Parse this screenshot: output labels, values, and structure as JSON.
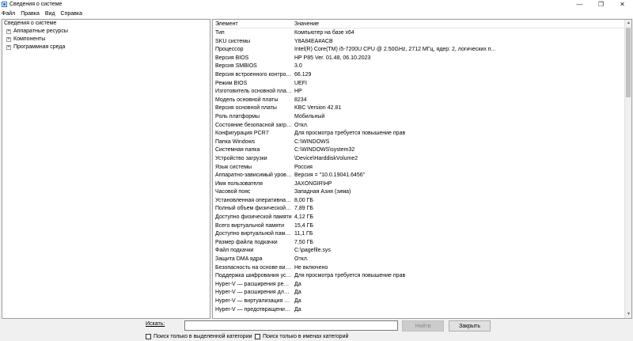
{
  "window": {
    "title": "Сведения о системе",
    "minimize_glyph": "—",
    "maximize_glyph": "❐",
    "close_glyph": "✕"
  },
  "menu": [
    "Файл",
    "Правка",
    "Вид",
    "Справка"
  ],
  "tree": {
    "root": "Сведения о системе",
    "children": [
      "Аппаратные ресурсы",
      "Компоненты",
      "Программная среда"
    ]
  },
  "grid": {
    "headers": {
      "element": "Элемент",
      "value": "Значение"
    },
    "rows": [
      {
        "element": "Тип",
        "value": "Компьютер на базе x64"
      },
      {
        "element": "SKU системы",
        "value": "Y8A84EA#ACB"
      },
      {
        "element": "Процессор",
        "value": "Intel(R) Core(TM) i5-7200U CPU @ 2.50GHz, 2712 МГц, ядер: 2, логических п..."
      },
      {
        "element": "Версия BIOS",
        "value": "HP P85 Ver. 01.48, 06.10.2023"
      },
      {
        "element": "Версия SMBIOS",
        "value": "3.0"
      },
      {
        "element": "Версия встроенного контролл...",
        "value": "66.129"
      },
      {
        "element": "Режим BIOS",
        "value": "UEFI"
      },
      {
        "element": "Изготовитель основной платы",
        "value": "HP"
      },
      {
        "element": "Модель основной платы",
        "value": "8234"
      },
      {
        "element": "Версия основной платы",
        "value": "KBC Version 42.81"
      },
      {
        "element": "Роль платформы",
        "value": "Мобильный"
      },
      {
        "element": "Состояние безопасной загруз...",
        "value": "Откл."
      },
      {
        "element": "Конфигурация PCR7",
        "value": "Для просмотра требуется повышение прав"
      },
      {
        "element": "Папка Windows",
        "value": "C:\\WINDOWS"
      },
      {
        "element": "Системная папка",
        "value": "C:\\WINDOWS\\system32"
      },
      {
        "element": "Устройство загрузки",
        "value": "\\Device\\HarddiskVolume2"
      },
      {
        "element": "Язык системы",
        "value": "Россия"
      },
      {
        "element": "Аппаратно-зависимый уровен...",
        "value": "Версия = \"10.0.19041.6456\""
      },
      {
        "element": "Имя пользователя",
        "value": "JAXONGIR\\HP"
      },
      {
        "element": "Часовой пояс",
        "value": "Западная Азия (зима)"
      },
      {
        "element": "Установленная оперативная п...",
        "value": "8,00 ГБ"
      },
      {
        "element": "Полный объем физической па...",
        "value": "7,89 ГБ"
      },
      {
        "element": "Доступно физической памяти",
        "value": "4,12 ГБ"
      },
      {
        "element": "Всего виртуальной памяти",
        "value": "15,4 ГБ"
      },
      {
        "element": "Доступно виртуальной памяти",
        "value": "11,1 ГБ"
      },
      {
        "element": "Размер файла подкачки",
        "value": "7,50 ГБ"
      },
      {
        "element": "Файл подкачки",
        "value": "C:\\pagefile.sys"
      },
      {
        "element": "Защита DMA ядра",
        "value": "Откл."
      },
      {
        "element": "Безопасность на основе вирту...",
        "value": "Не включено"
      },
      {
        "element": "Поддержка шифрования устр...",
        "value": "Для просмотра требуется повышение прав"
      },
      {
        "element": "Hyper-V — расширения режи...",
        "value": "Да"
      },
      {
        "element": "Hyper-V — расширения для п...",
        "value": "Да"
      },
      {
        "element": "Hyper-V — виртуализация вкл...",
        "value": "Да"
      },
      {
        "element": "Hyper-V — предотвращение в...",
        "value": "Да"
      }
    ]
  },
  "search": {
    "label": "Искать:",
    "value": "",
    "find_label": "Найти",
    "close_label": "Закрыть",
    "checkbox_selected": "Поиск только в выделенной категории",
    "checkbox_names": "Поиск только в именах категорий"
  }
}
